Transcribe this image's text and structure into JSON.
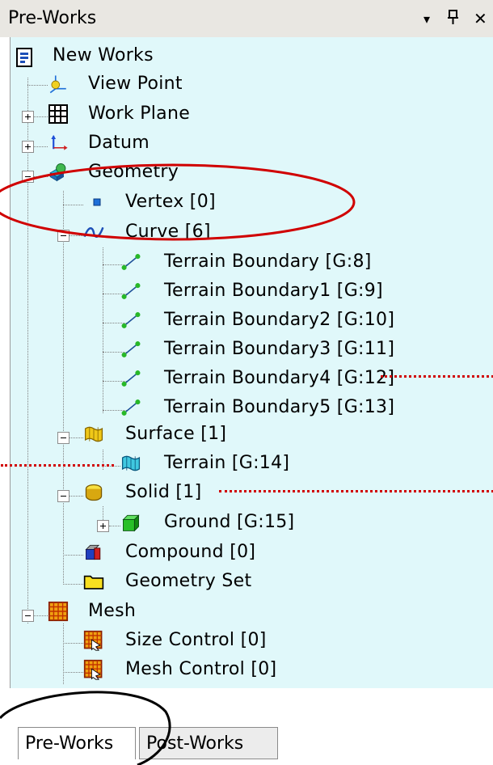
{
  "panel": {
    "title": "Pre-Works",
    "dropdown_icon": "▾",
    "pin_icon": "ᵖ",
    "close_icon": "✕"
  },
  "tree": {
    "root": "New Works",
    "view_point": "View Point",
    "work_plane": "Work Plane",
    "datum": "Datum",
    "geometry": "Geometry",
    "vertex": "Vertex [0]",
    "curve": "Curve [6]",
    "curves": [
      "Terrain Boundary [G:8]",
      "Terrain Boundary1 [G:9]",
      "Terrain Boundary2 [G:10]",
      "Terrain Boundary3 [G:11]",
      "Terrain Boundary4 [G:12]",
      "Terrain Boundary5 [G:13]"
    ],
    "surface": "Surface [1]",
    "terrain": "Terrain [G:14]",
    "solid": "Solid [1]",
    "ground": "Ground [G:15]",
    "compound": "Compound [0]",
    "geometry_set": "Geometry Set",
    "mesh": "Mesh",
    "size_control": "Size Control [0]",
    "mesh_control": "Mesh Control [0]"
  },
  "tabs": {
    "pre": "Pre-Works",
    "post": "Post-Works"
  },
  "colors": {
    "tree_background": "#e0f8fa",
    "annotation_red": "#d00000",
    "annotation_black": "#000000"
  }
}
